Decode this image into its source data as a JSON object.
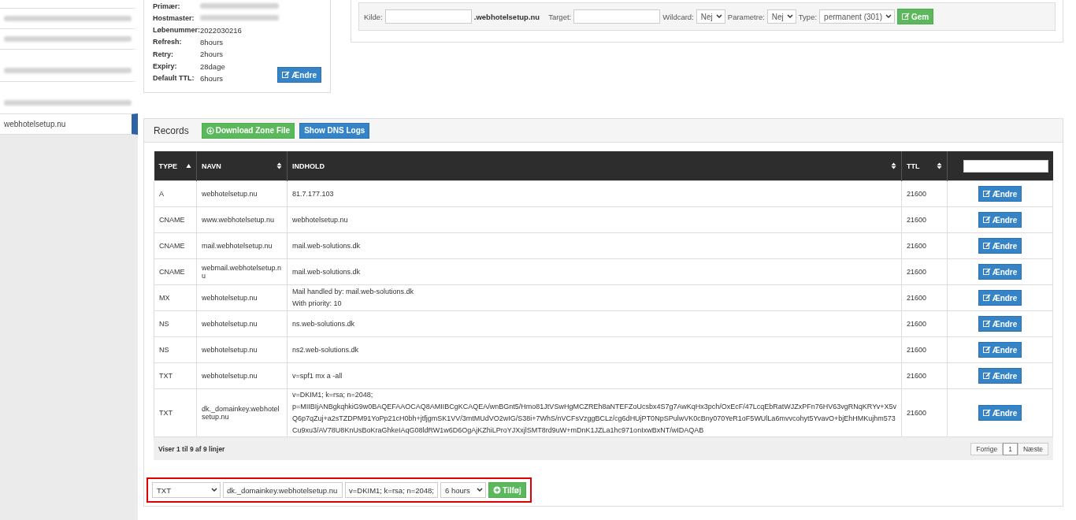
{
  "sidebar": {
    "items": [
      {
        "redacted": true,
        "selected": false
      },
      {
        "redacted": true,
        "selected": false
      },
      {
        "redacted": true,
        "selected": false
      },
      {
        "redacted": true,
        "selected": false
      },
      {
        "label": "webhotelsetup.nu",
        "redacted": false,
        "selected": true
      }
    ]
  },
  "soa": {
    "fields": [
      {
        "label": "Primær:",
        "redacted": true
      },
      {
        "label": "Hostmaster:",
        "redacted": true
      },
      {
        "label": "Løbenummer:",
        "value": "2022030216",
        "redacted": false
      },
      {
        "label": "Refresh:",
        "value": "8hours",
        "redacted": false
      },
      {
        "label": "Retry:",
        "value": "2hours",
        "redacted": false
      },
      {
        "label": "Expiry:",
        "value": "28dage",
        "redacted": false
      },
      {
        "label": "Default TTL:",
        "value": "6hours",
        "redacted": false
      }
    ],
    "edit_button": "Ændre"
  },
  "redirect_form": {
    "source_label": "Kilde:",
    "domain_suffix": ".webhotelsetup.nu",
    "target_label": "Target:",
    "wildcard_label": "Wildcard:",
    "wildcard_value": "Nej",
    "parameters_label": "Parametre:",
    "parameters_value": "Nej",
    "type_label": "Type:",
    "type_value": "permanent (301)",
    "save_button": "Gem"
  },
  "records": {
    "title": "Records",
    "download_button": "Download Zone File",
    "logs_button": "Show DNS Logs",
    "table": {
      "columns": [
        {
          "label": "TYPE",
          "sorted_ascending": true
        },
        {
          "label": "NAVN",
          "sorted_ascending": false
        },
        {
          "label": "INDHOLD",
          "sorted_ascending": false
        },
        {
          "label": "TTL",
          "sorted_ascending": false
        }
      ],
      "rows": [
        {
          "type": "A",
          "name": "webhotelsetup.nu",
          "content": [
            "81.7.177.103"
          ],
          "ttl": "21600",
          "action": "Ændre"
        },
        {
          "type": "CNAME",
          "name": "www.webhotelsetup.nu",
          "content": [
            "webhotelsetup.nu"
          ],
          "ttl": "21600",
          "action": "Ændre"
        },
        {
          "type": "CNAME",
          "name": "mail.webhotelsetup.nu",
          "content": [
            "mail.web-solutions.dk"
          ],
          "ttl": "21600",
          "action": "Ændre"
        },
        {
          "type": "CNAME",
          "name": "webmail.webhotelsetup.nu",
          "content": [
            "mail.web-solutions.dk"
          ],
          "ttl": "21600",
          "action": "Ændre"
        },
        {
          "type": "MX",
          "name": "webhotelsetup.nu",
          "content": [
            "Mail handled by: mail.web-solutions.dk",
            "With priority: 10"
          ],
          "ttl": "21600",
          "action": "Ændre"
        },
        {
          "type": "NS",
          "name": "webhotelsetup.nu",
          "content": [
            "ns.web-solutions.dk"
          ],
          "ttl": "21600",
          "action": "Ændre"
        },
        {
          "type": "NS",
          "name": "webhotelsetup.nu",
          "content": [
            "ns2.web-solutions.dk"
          ],
          "ttl": "21600",
          "action": "Ændre"
        },
        {
          "type": "TXT",
          "name": "webhotelsetup.nu",
          "content": [
            "v=spf1 mx a -all"
          ],
          "ttl": "21600",
          "action": "Ændre"
        },
        {
          "type": "TXT",
          "name": "dk._domainkey.webhotelsetup.nu",
          "content": [
            "v=DKIM1; k=rsa; n=2048;",
            "p=MIIBIjANBgkqhkiG9w0BAQEFAAOCAQ8AMIIBCgKCAQEA/wnBGnt5/Hmo81JtVSwHgMCZREh8aNTEFZoUcsbx4S7g7AwKqHx3pch/OxEcF/47LcqEbRatWJZxPFn76HV63vgRNqKRYv+X5vQ6p7qZuj+a2sTZDPM91YoPp21cH0bh+jtfjgmSK1VV/3mtMUdVO2wIG/S38i+7WhS/nVCFsVzggBCLz/cg6dHUjPT0NpSPulwVK0cBny070YeR1oF5WUlLa6mvvcohyt5YvavO+bjEhHMKujhm573Cu9xu3/AV78U8KnUsBoKraGhkeIAqG08ldRW1w6D6OgAjKZhiLProYJXxjlSMT8rd9uW+mDnK1JZLa1hc971onIxwBxNT/wIDAQAB"
          ],
          "ttl": "21600",
          "action": "Ændre"
        }
      ],
      "info": "Viser 1 til 9 af 9 linjer",
      "pagination": [
        {
          "label": "Forrige",
          "selected": false
        },
        {
          "label": "1",
          "selected": true
        },
        {
          "label": "Næste",
          "selected": false
        }
      ]
    }
  },
  "add_form": {
    "highlighted": true,
    "type_value": "TXT",
    "name_value": "dk._domainkey.webhotelsetup.nu",
    "content_value": "v=DKIM1; k=rsa; n=2048;",
    "ttl_value": "6 hours",
    "add_button": "Tilføj"
  }
}
